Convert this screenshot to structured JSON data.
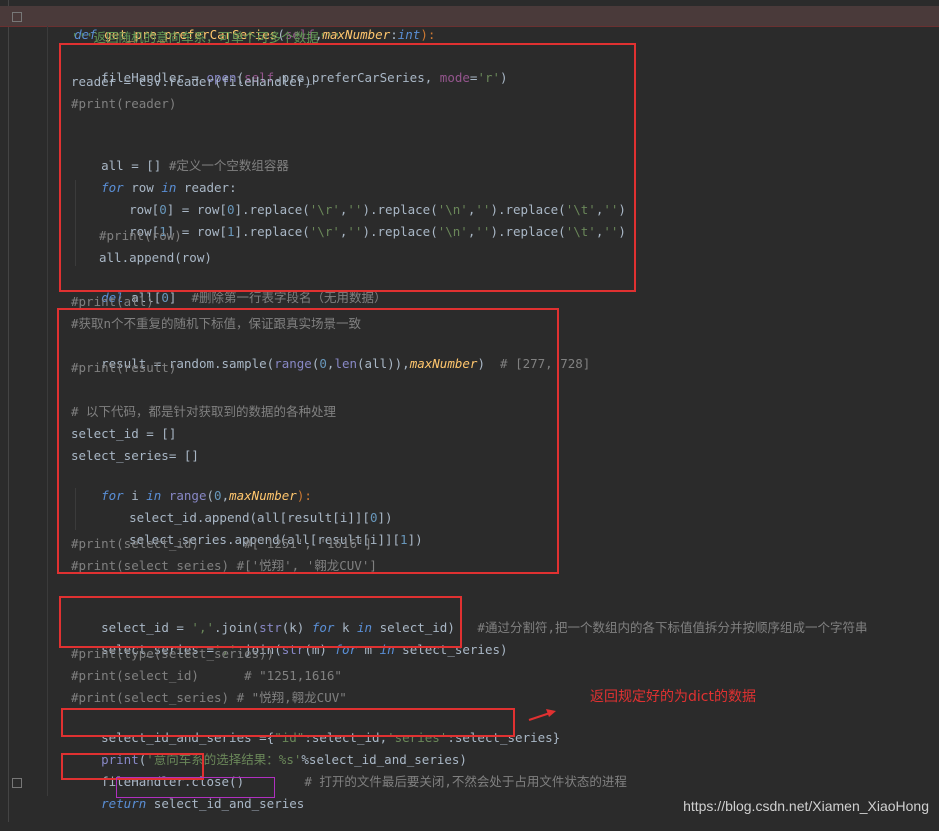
{
  "lines": {
    "l01": {
      "def": "def",
      "name": "get_pre_preferCarSeries",
      "p1": "(",
      "self": "self",
      "c": ",",
      "param": "maxNumber",
      "colon": ":",
      "type": "int",
      "end": "):"
    },
    "l02": "'''返回随机的意向车系，可单个可多个数据'''",
    "l03": {
      "a": "fileHandler = ",
      "open": "open",
      "b": "(",
      "self": "self",
      "c": ".pre_preferCarSeries, ",
      "kw": "mode",
      "eq": "=",
      "s": "'r'",
      "d": ")"
    },
    "l04": "reader = csv.reader(fileHandler)",
    "l05": "#print(reader)",
    "l07": {
      "a": "all = [] ",
      "cmt": "#定义一个空数组容器"
    },
    "l08": {
      "for": "for",
      "a": " row ",
      "in": "in",
      "b": " reader:"
    },
    "l09": {
      "a": "row[",
      "n0": "0",
      "b": "] = row[",
      "n1": "0",
      "c": "].replace(",
      "s1": "'\\r'",
      "d": ",",
      "s2": "''",
      "e": ").replace(",
      "s3": "'\\n'",
      "f": ",",
      "s4": "''",
      "g": ").replace(",
      "s5": "'\\t'",
      "h": ",",
      "s6": "''",
      "i": ")"
    },
    "l10": {
      "a": "row[",
      "n0": "1",
      "b": "] = row[",
      "n1": "1",
      "c": "].replace(",
      "s1": "'\\r'",
      "d": ",",
      "s2": "''",
      "e": ").replace(",
      "s3": "'\\n'",
      "f": ",",
      "s4": "''",
      "g": ").replace(",
      "s5": "'\\t'",
      "h": ",",
      "s6": "''",
      "i": ")"
    },
    "l11": "#print(row)",
    "l12": "all.append(row)",
    "l13": {
      "del": "del",
      "a": " all[",
      "n": "0",
      "b": "]  ",
      "cmt": "#删除第一行表字段名（无用数据）"
    },
    "l14": "#print(all)",
    "l15": "#获取n个不重复的随机下标值，保证跟真实场景一致",
    "l16": {
      "a": "result = random.sample(",
      "range": "range",
      "b": "(",
      "n": "0",
      "c": ",",
      "len": "len",
      "d": "(all)),",
      "p": "maxNumber",
      "e": ")  ",
      "cmt": "# [277, 728]"
    },
    "l17": "#print(result)",
    "l19": "# 以下代码，都是针对获取到的数据的各种处理",
    "l20": "select_id = []",
    "l21": "select_series= []",
    "l22": {
      "for": "for",
      "a": " i ",
      "in": "in",
      "sp": " ",
      "range": "range",
      "b": "(",
      "n": "0",
      "c": ",",
      "p": "maxNumber",
      "d": "):"
    },
    "l23": {
      "a": "select_id.append(all[result[i]][",
      "n": "0",
      "b": "])"
    },
    "l24": {
      "a": "select_series.append(all[result[i]][",
      "n": "1",
      "b": "])"
    },
    "l25": "#print(select_id)      #['1251', '1616']",
    "l26": "#print(select_series) #['悦翔', '翱龙CUV']",
    "l28": {
      "a": "select_id = ",
      "s": "','",
      "b": ".join(",
      "str": "str",
      "c": "(k) ",
      "for": "for",
      "d": " k ",
      "in": "in",
      "e": " select_id)   ",
      "cmt": "#通过分割符,把一个数组内的各下标值值拆分并按顺序组成一个字符串"
    },
    "l29": {
      "a": "select_series =",
      "s": "','",
      "b": ".join(",
      "str": "str",
      "c": "(m) ",
      "for": "for",
      "d": " m ",
      "in": "in",
      "e": " select_series)"
    },
    "l30": "#print(type(select_series))",
    "l31": "#print(select_id)      # \"1251,1616\"",
    "l32": "#print(select_series) # \"悦翔,翱龙CUV\"",
    "l33": {
      "a": "select_id_and_series ={",
      "s1": "\"id\"",
      "b": ":select_id,",
      "s2": "'series'",
      "c": ":select_series}"
    },
    "l34": {
      "print": "print",
      "a": "(",
      "s": "'意向车系的选择结果：%s'",
      "b": "%select_id_and_series)"
    },
    "l35": {
      "a": "fileHandler.close()",
      "cmt": "        # 打开的文件最后要关闭,不然会处于占用文件状态的进程"
    },
    "l36": {
      "ret": "return",
      "sp": " ",
      "a": "select_id_and_series"
    }
  },
  "annotation": "返回规定好的为dict的数据",
  "watermark": "https://blog.csdn.net/Xiamen_XiaoHong",
  "colors": {
    "highlight_box": "#e03131",
    "return_box": "#b030c0",
    "background": "#2b2b2b"
  }
}
